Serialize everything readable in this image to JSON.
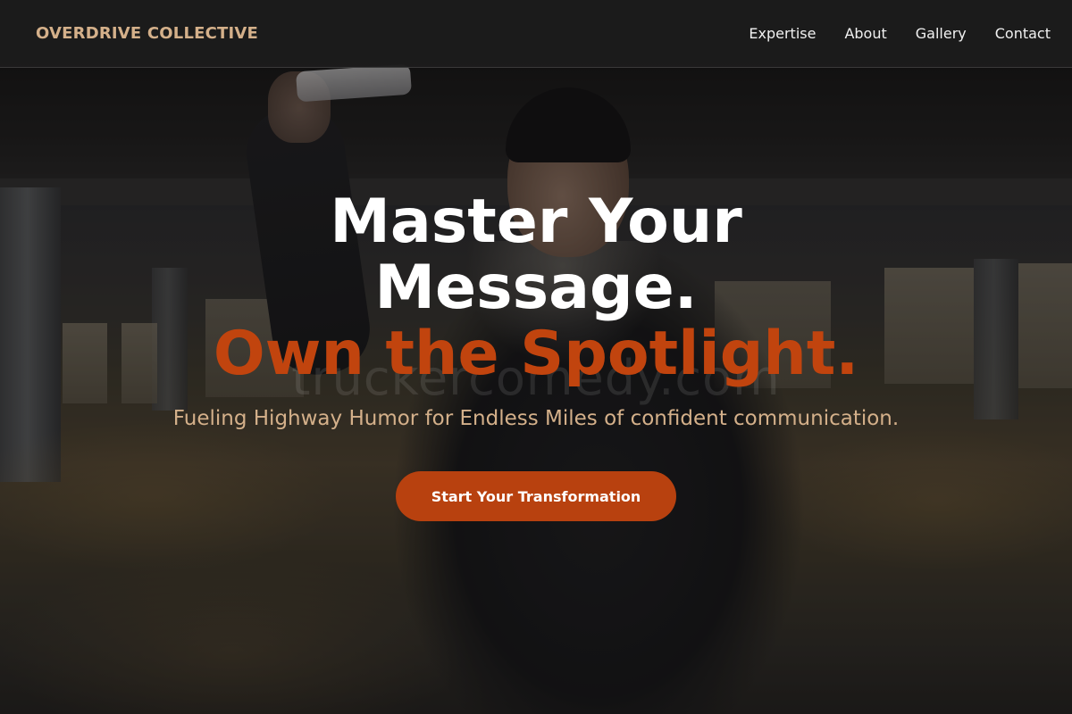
{
  "header": {
    "brand": "OVERDRIVE COLLECTIVE",
    "nav": [
      {
        "label": "Expertise"
      },
      {
        "label": "About"
      },
      {
        "label": "Gallery"
      },
      {
        "label": "Contact"
      }
    ]
  },
  "hero": {
    "headline_line1": "Master Your",
    "headline_line2": "Message.",
    "headline_accent": "Own the Spotlight.",
    "subheadline": "Fueling Highway Humor for Endless Miles of confident communication.",
    "cta_label": "Start Your Transformation",
    "watermark": "truckercomedy.com"
  },
  "colors": {
    "brand": "#d4b08a",
    "accent": "#c1440e",
    "button": "#b8410f",
    "header_bg": "#1c1c1c"
  }
}
